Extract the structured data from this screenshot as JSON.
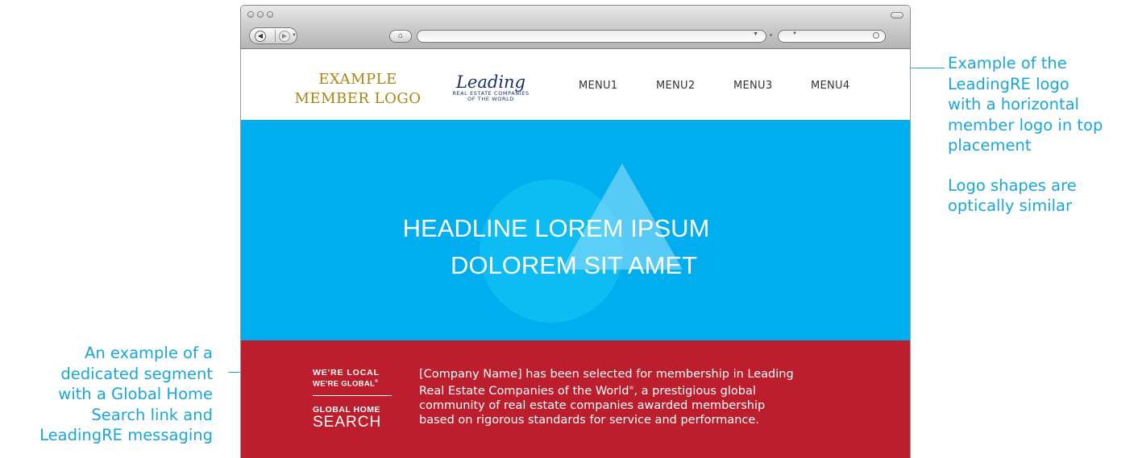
{
  "annotations": {
    "right_lines": [
      "Example of the",
      "LeadingRE logo",
      "with a horizontal",
      "member logo in top",
      "placement"
    ],
    "right_note_lines": [
      "Logo shapes are",
      "optically similar"
    ],
    "left_lines": [
      "An example of a",
      "dedicated segment",
      "with a Global Home",
      "Search link and",
      "LeadingRE messaging"
    ],
    "accent_color": "#1aa6dc"
  },
  "browser": {
    "icons": [
      "back-arrow-icon",
      "forward-arrow-icon",
      "home-icon",
      "dropdown-icon",
      "search-icon"
    ],
    "url_value": "",
    "search_value": ""
  },
  "header": {
    "member_logo_lines": [
      "EXAMPLE",
      "MEMBER LOGO"
    ],
    "lre_logo": {
      "script": "Leading",
      "line1": "REAL ESTATE COMPANIES",
      "line2": "OF THE WORLD"
    },
    "menu": [
      "MENU1",
      "MENU2",
      "MENU3",
      "MENU4"
    ]
  },
  "hero": {
    "headline_line1": "HEADLINE LOREM IPSUM",
    "headline_line2": "DOLOREM SIT AMET",
    "color": "#00adee"
  },
  "segment": {
    "tagline1": "WE'RE LOCAL",
    "tagline2": "WE'RE GLOBAL",
    "tagline2_mark": "®",
    "link_small": "GLOBAL HOME",
    "link_large": "SEARCH",
    "message_lines": [
      "[Company Name] has been selected for membership in Leading",
      "Real Estate Companies of the World",
      ", a prestigious global",
      "community of real estate companies awarded membership",
      "based on rigorous standards for service and performance."
    ],
    "message_mark": "®",
    "color": "#bd1e2d"
  }
}
